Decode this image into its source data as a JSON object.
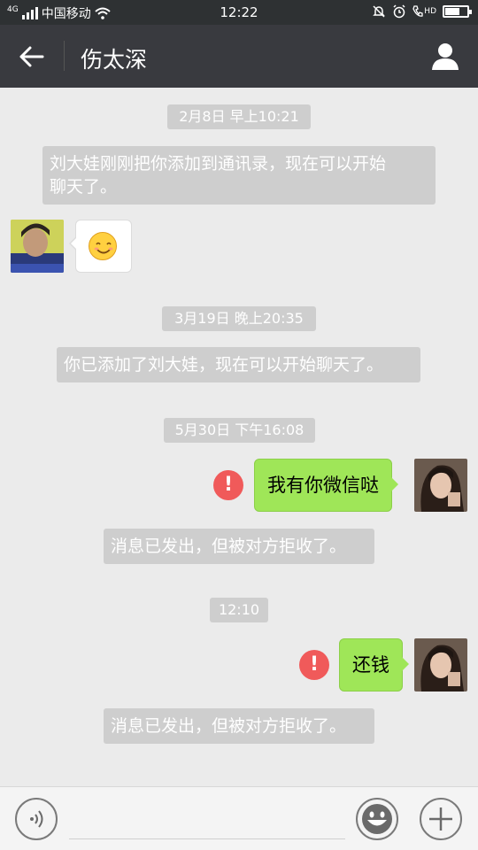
{
  "status_bar": {
    "network": "4G",
    "carrier": "中国移动",
    "time": "12:22",
    "hd_label": "HD"
  },
  "header": {
    "title": "伤太深",
    "back_icon": "arrow-left-icon",
    "profile_icon": "person-icon"
  },
  "messages": [
    {
      "type": "time",
      "text": "2月8日 早上10:21"
    },
    {
      "type": "system",
      "text_line1": "刘大娃刚刚把你添加到通讯录，现在可以开始",
      "text_line2": "聊天了。"
    },
    {
      "type": "incoming",
      "content": "smile-emoji",
      "emoji": "😊"
    },
    {
      "type": "time",
      "text": "3月19日 晚上20:35"
    },
    {
      "type": "system",
      "text": "你已添加了刘大娃，现在可以开始聊天了。"
    },
    {
      "type": "time",
      "text": "5月30日 下午16:08"
    },
    {
      "type": "outgoing",
      "text": "我有你微信哒",
      "error": "!"
    },
    {
      "type": "system",
      "text": "消息已发出，但被对方拒收了。"
    },
    {
      "type": "time",
      "text": "12:10"
    },
    {
      "type": "outgoing",
      "text": "还钱",
      "error": "!"
    },
    {
      "type": "system",
      "text": "消息已发出，但被对方拒收了。"
    }
  ],
  "input_bar": {
    "voice_icon": "voice-icon",
    "emoji_icon": "emoji-icon",
    "plus_icon": "plus-icon",
    "input_value": ""
  },
  "colors": {
    "nav_bg": "#393a3f",
    "chat_bg": "#ebebeb",
    "outgoing_bubble": "#9fe658",
    "error_red": "#f05a5a",
    "system_chip": "#cecece"
  }
}
